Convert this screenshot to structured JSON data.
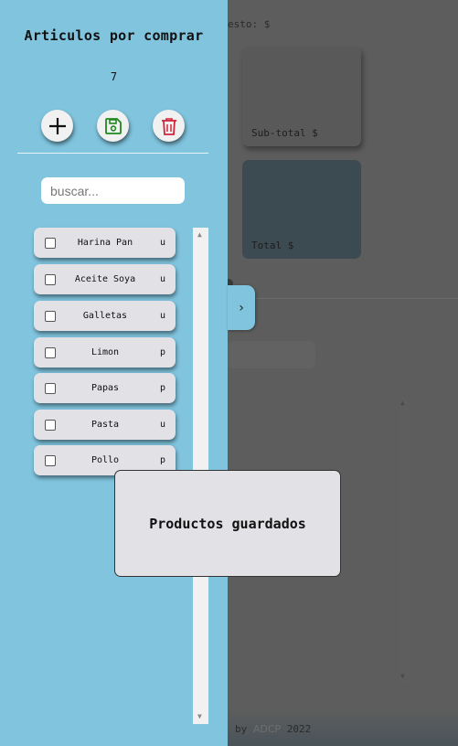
{
  "main": {
    "presupuesto_label": "esto: $",
    "subtotal_label": "Sub-total $",
    "total_label": "Total $",
    "footer": {
      "prefix": "by",
      "logo": "ADCP",
      "year": "2022"
    }
  },
  "sidebar": {
    "title": "Articulos por comprar",
    "count": "7",
    "search": {
      "placeholder": "buscar...",
      "value": ""
    },
    "items": [
      {
        "name": "Harina Pan",
        "unit": "u",
        "checked": false
      },
      {
        "name": "Aceite Soya",
        "unit": "u",
        "checked": false
      },
      {
        "name": "Galletas",
        "unit": "u",
        "checked": false
      },
      {
        "name": "Limon",
        "unit": "p",
        "checked": false
      },
      {
        "name": "Papas",
        "unit": "p",
        "checked": false
      },
      {
        "name": "Pasta",
        "unit": "u",
        "checked": false
      },
      {
        "name": "Pollo",
        "unit": "p",
        "checked": false
      }
    ],
    "toggle_icon": "chevron-right-icon"
  },
  "icons": {
    "add": "plus-icon",
    "save": "floppy-disk-icon",
    "delete": "trash-icon"
  },
  "colors": {
    "sidebar_bg": "#80c4de",
    "save_icon": "#1e8a1e",
    "delete_icon": "#d0243b",
    "overlay": "#5d5d5d"
  },
  "toast": {
    "message": "Productos guardados"
  }
}
